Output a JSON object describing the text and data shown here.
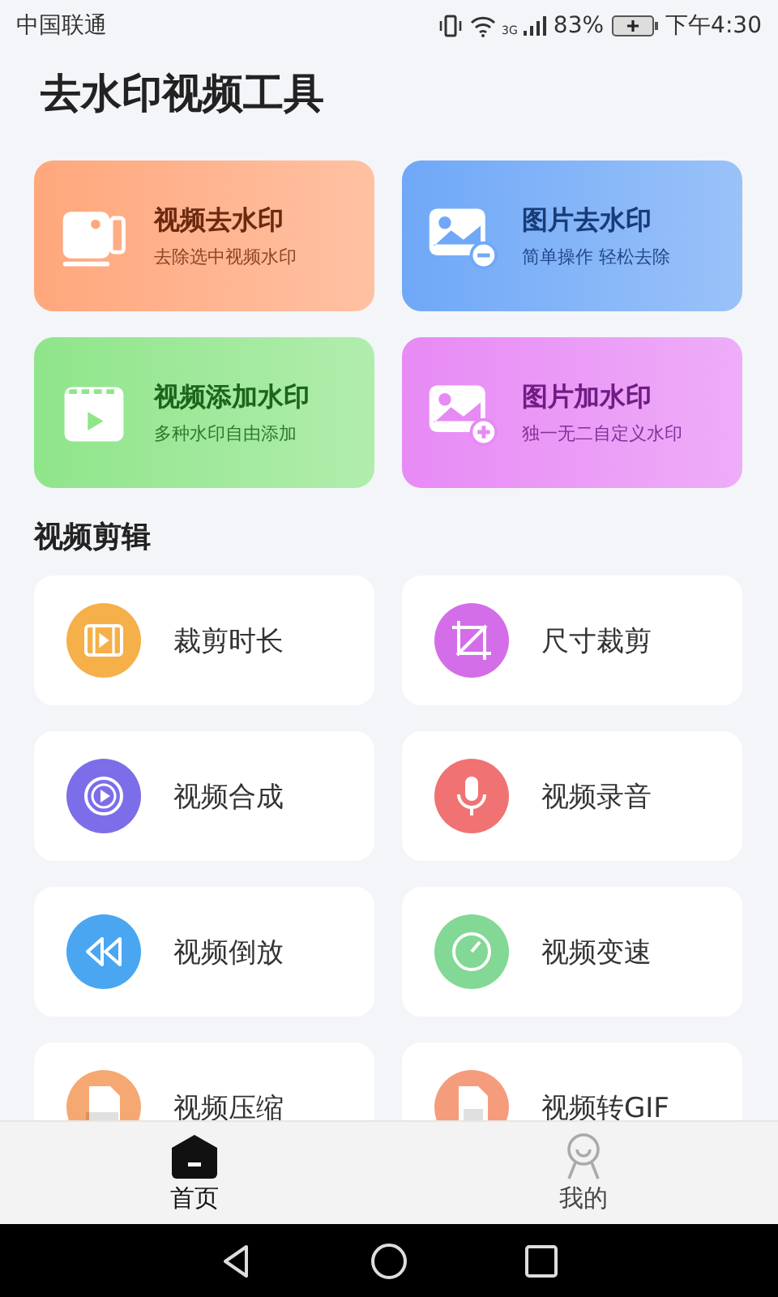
{
  "status_bar": {
    "carrier": "中国联通",
    "network": "3G",
    "battery": "83%",
    "time": "下午4:30"
  },
  "title": "去水印视频工具",
  "feature_cards": [
    {
      "kind": "video-remove",
      "title": "视频去水印",
      "subtitle": "去除选中视频水印",
      "color": "#ffa77c"
    },
    {
      "kind": "image-remove",
      "title": "图片去水印",
      "subtitle": "简单操作 轻松去除",
      "color": "#6fa8f7"
    },
    {
      "kind": "video-add",
      "title": "视频添加水印",
      "subtitle": "多种水印自由添加",
      "color": "#8fe58a"
    },
    {
      "kind": "image-add",
      "title": "图片加水印",
      "subtitle": "独一无二自定义水印",
      "color": "#e78af5"
    }
  ],
  "section_title": "视频剪辑",
  "tools": [
    {
      "kind": "trim",
      "label": "裁剪时长",
      "color": "#f5b04a"
    },
    {
      "kind": "crop",
      "label": "尺寸裁剪",
      "color": "#d46ee8"
    },
    {
      "kind": "merge",
      "label": "视频合成",
      "color": "#7c6ee8"
    },
    {
      "kind": "record",
      "label": "视频录音",
      "color": "#f07272"
    },
    {
      "kind": "reverse",
      "label": "视频倒放",
      "color": "#4aa6f0"
    },
    {
      "kind": "speed",
      "label": "视频变速",
      "color": "#82d894"
    },
    {
      "kind": "compress",
      "label": "视频压缩",
      "color": "#f6a872"
    },
    {
      "kind": "gif",
      "label": "视频转GIF",
      "color": "#f59c7c"
    }
  ],
  "tab_bar": [
    {
      "label": "首页",
      "selected": true
    },
    {
      "label": "我的",
      "selected": false
    }
  ]
}
